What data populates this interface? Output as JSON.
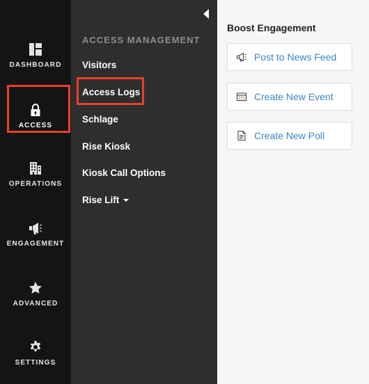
{
  "rail": {
    "items": [
      {
        "label": "DASHBOARD",
        "icon": "dashboard-icon"
      },
      {
        "label": "ACCESS",
        "icon": "lock-icon",
        "active": true
      },
      {
        "label": "OPERATIONS",
        "icon": "building-icon"
      },
      {
        "label": "ENGAGEMENT",
        "icon": "megaphone-icon"
      },
      {
        "label": "ADVANCED",
        "icon": "star-icon"
      },
      {
        "label": "SETTINGS",
        "icon": "gear-icon"
      }
    ]
  },
  "submenu": {
    "title": "ACCESS MANAGEMENT",
    "collapse_icon": "caret-left-icon",
    "items": [
      {
        "label": "Visitors"
      },
      {
        "label": "Access Logs",
        "highlighted": true
      },
      {
        "label": "Schlage"
      },
      {
        "label": "Rise Kiosk"
      },
      {
        "label": "Kiosk Call Options"
      },
      {
        "label": "Rise Lift",
        "has_dropdown": true
      }
    ]
  },
  "main": {
    "heading": "Boost Engagement",
    "actions": [
      {
        "label": "Post to News Feed",
        "icon": "megaphone-icon"
      },
      {
        "label": "Create New Event",
        "icon": "calendar-icon"
      },
      {
        "label": "Create New Poll",
        "icon": "document-icon"
      }
    ]
  },
  "colors": {
    "rail_bg": "#141414",
    "submenu_bg": "#2e2e2e",
    "main_bg": "#f6f6f6",
    "highlight": "#e8412c",
    "link": "#3a84c9"
  }
}
